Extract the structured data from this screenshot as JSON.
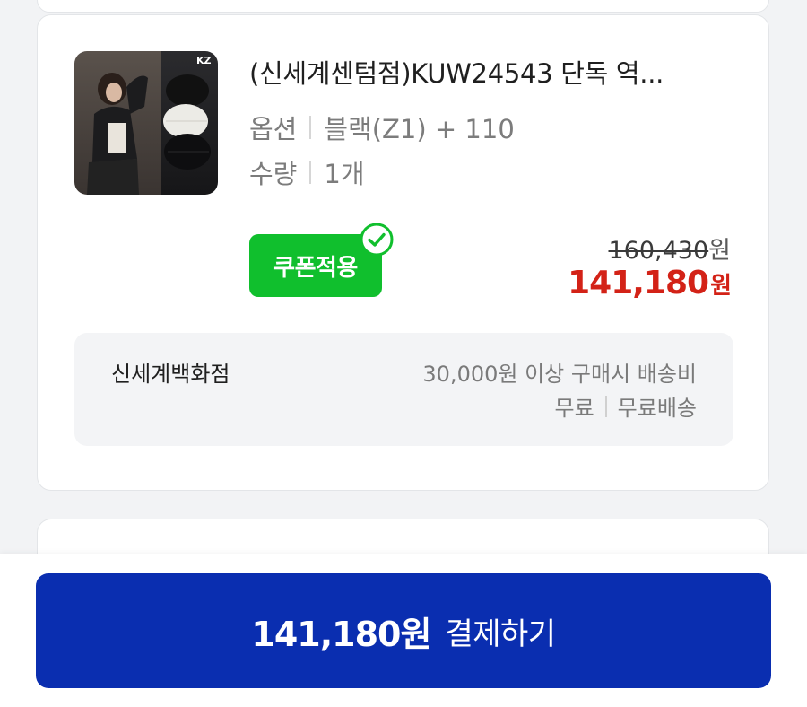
{
  "product": {
    "title": "(신세계센텀점)KUW24543 단독 역...",
    "option_label": "옵션",
    "option_value": "블랙(Z1) + 110",
    "quantity_label": "수량",
    "quantity_value": "1개",
    "thumbnail_logo_text": "KZ",
    "coupon_label": "쿠폰적용",
    "original_price": "160,430",
    "original_price_unit": "원",
    "sale_price": "141,180",
    "sale_price_unit": "원"
  },
  "shipping": {
    "seller": "신세계백화점",
    "condition": "30,000원 이상 구매시 배송비",
    "fee": "무료",
    "method": "무료배송"
  },
  "checkout": {
    "amount": "141,180원",
    "action_label": "결제하기"
  },
  "colors": {
    "pay_button": "#0a2eb0",
    "coupon_badge": "#10bf2d",
    "sale_price": "#d32217",
    "background": "#f2f3f5"
  },
  "icons": {
    "coupon_status": "check-circle-icon"
  }
}
